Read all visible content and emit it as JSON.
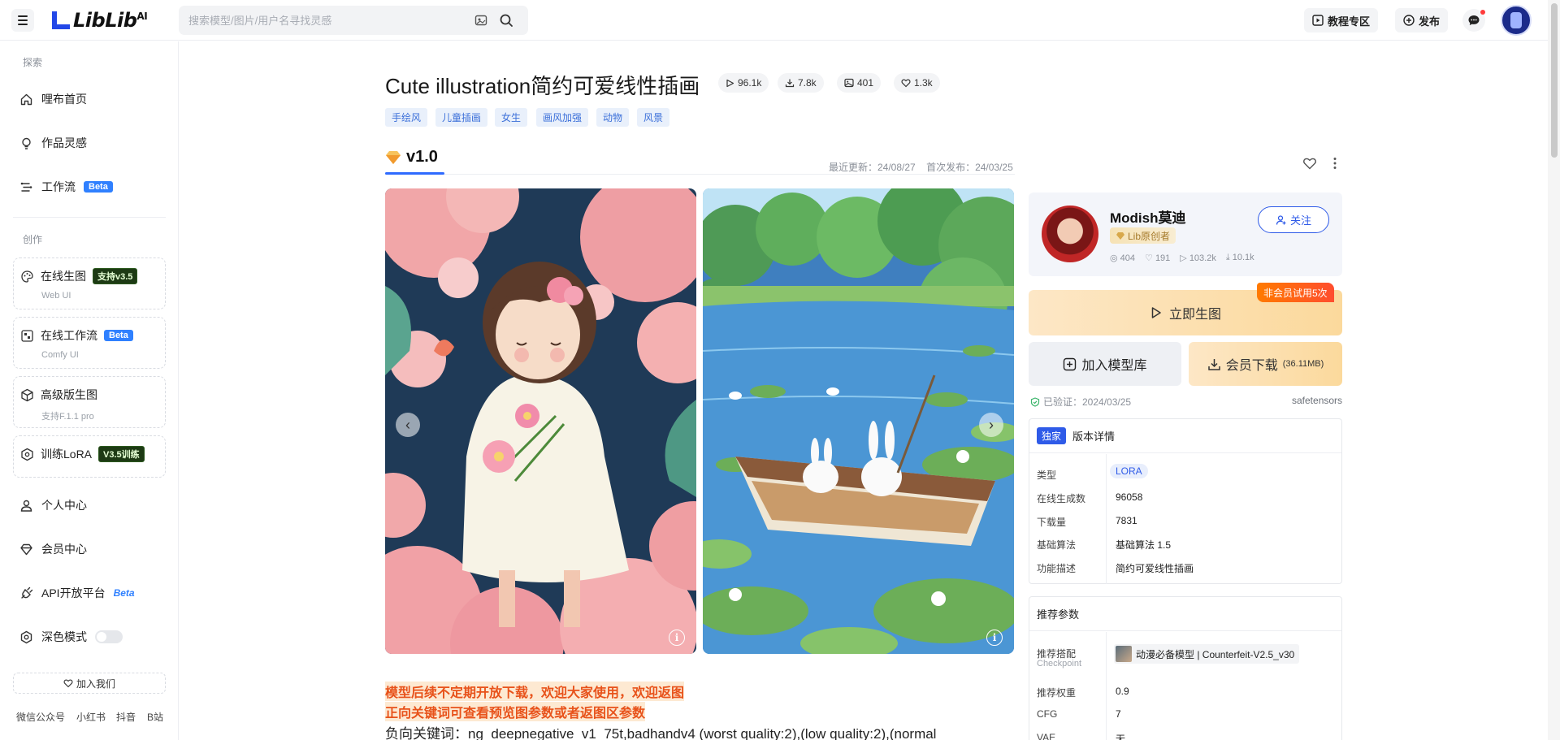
{
  "header": {
    "logo_text": "LibLib",
    "logo_sup": "AI",
    "search_placeholder": "搜索模型/图片/用户名寻找灵感",
    "tutorial_label": "教程专区",
    "publish_label": "发布"
  },
  "sidebar": {
    "explore_label": "探索",
    "items_explore": [
      {
        "label": "哩布首页",
        "icon": "home-icon"
      },
      {
        "label": "作品灵感",
        "icon": "bulb-icon"
      },
      {
        "label": "工作流",
        "icon": "workflow-icon",
        "badge": "Beta"
      }
    ],
    "create_label": "创作",
    "cards": [
      {
        "label": "在线生图",
        "badge": "支持v3.5",
        "sub": "Web UI",
        "icon": "palette-icon"
      },
      {
        "label": "在线工作流",
        "badge": "Beta",
        "sub": "Comfy UI",
        "icon": "flow-icon"
      },
      {
        "label": "高级版生图",
        "sub": "支持F.1.1 pro",
        "icon": "cube-icon"
      },
      {
        "label": "训练LoRA",
        "badge": "V3.5训练",
        "icon": "train-icon"
      }
    ],
    "items_user": [
      {
        "label": "个人中心",
        "icon": "user-icon"
      },
      {
        "label": "会员中心",
        "icon": "diamond-icon"
      },
      {
        "label": "API开放平台",
        "icon": "api-icon",
        "badge": "Beta"
      },
      {
        "label": "深色模式",
        "icon": "settings-icon"
      }
    ],
    "join_label": "加入我们",
    "social": [
      "微信公众号",
      "小红书",
      "抖音",
      "B站"
    ]
  },
  "model": {
    "title": "Cute illustration简约可爱线性插画",
    "stats": {
      "runs": "96.1k",
      "downloads": "7.8k",
      "images": "401",
      "likes": "1.3k"
    },
    "tags": [
      "手绘风",
      "儿童插画",
      "女生",
      "画风加强",
      "动物",
      "风景"
    ],
    "version": "v1.0",
    "updated": "最近更新：24/08/27",
    "published": "首次发布：24/03/25",
    "desc_lines": [
      "模型后续不定期开放下载，欢迎大家使用，欢迎返图",
      "正向关键词可查看预览图参数或者返图区参数"
    ],
    "negative_prompt": "负向关键词：ng_deepnegative_v1_75t,badhandv4 (worst quality:2),(low quality:2),(normal"
  },
  "author": {
    "name": "Modish莫迪",
    "badge": "Lib原创者",
    "follow_label": "关注",
    "stats": {
      "followers": "404",
      "likes": "191",
      "runs": "103.2k",
      "downloads": "10.1k"
    }
  },
  "actions": {
    "trial_badge": "非会员试用5次",
    "generate_label": "立即生图",
    "add_lib_label": "加入模型库",
    "vip_download_label": "会员下载",
    "vip_download_size": "(36.11MB)",
    "verified": "已验证：2024/03/25",
    "format": "safetensors"
  },
  "version_details": {
    "exclusive": "独家",
    "title": "版本详情",
    "rows": [
      {
        "k": "类型",
        "v": "LORA"
      },
      {
        "k": "在线生成数",
        "v": "96058"
      },
      {
        "k": "下载量",
        "v": "7831"
      },
      {
        "k": "基础算法",
        "v": "基础算法 1.5"
      },
      {
        "k": "功能描述",
        "v": "简约可爱线性插画"
      }
    ]
  },
  "recommend": {
    "title": "推荐参数",
    "ckpt_label": "推荐搭配",
    "ckpt_sub": "Checkpoint",
    "ckpt_value": "动漫必备模型 | Counterfeit-V2.5_v30",
    "weight_label": "推荐权重",
    "weight_value": "0.9",
    "cfg_label": "CFG",
    "cfg_value": "7",
    "vae_label": "VAE",
    "vae_value": "无"
  },
  "colors": {
    "accent": "#2f5be8",
    "warning": "#e8521a"
  }
}
